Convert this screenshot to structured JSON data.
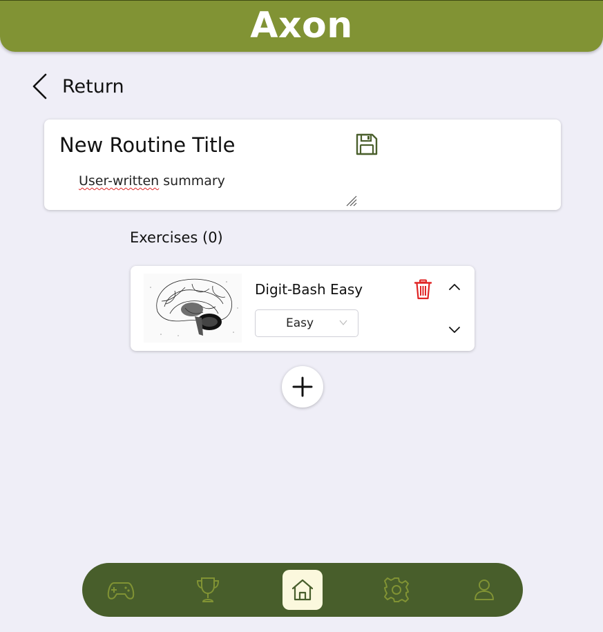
{
  "app": {
    "title": "Axon"
  },
  "nav_back": {
    "label": "Return"
  },
  "routine": {
    "title": "New Routine Title",
    "summary_first_word": "User-written",
    "summary_rest": " summary"
  },
  "exercises": {
    "header": "Exercises (0)",
    "items": [
      {
        "name": "Digit-Bash Easy",
        "difficulty": "Easy",
        "thumbnail": "brain-illustration"
      }
    ]
  },
  "colors": {
    "header_bg": "#819334",
    "nav_bg": "#485e2b",
    "nav_active_bg": "#fbf8dd",
    "accent_green": "#4a5f2c",
    "delete_red": "#e02424",
    "page_bg": "#efeef7"
  },
  "icons": {
    "save": "floppy-disk-icon",
    "delete": "trash-icon",
    "move_up": "chevron-up-icon",
    "move_down": "chevron-down-icon",
    "add": "plus-icon",
    "nav": [
      "gamepad-icon",
      "trophy-icon",
      "home-icon",
      "gear-icon",
      "user-icon"
    ]
  }
}
